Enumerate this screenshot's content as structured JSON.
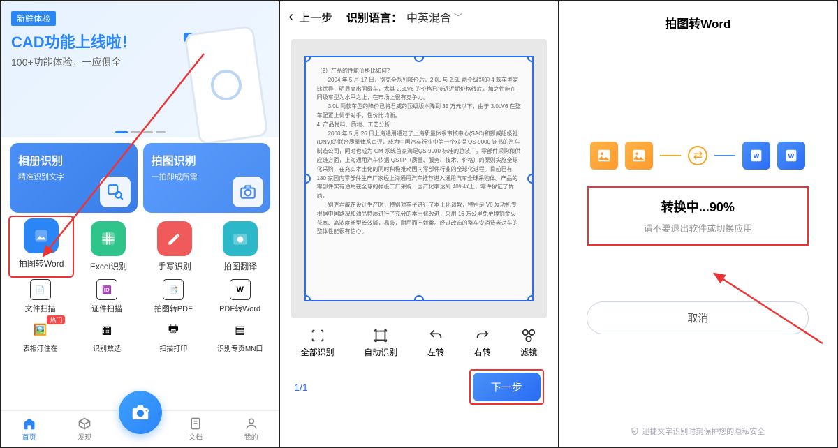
{
  "panel1": {
    "banner_badge": "新鲜体验",
    "banner_title": "CAD功能上线啦！",
    "banner_sub": "100+功能体验，一应俱全",
    "cad_tag": "CAD",
    "card_a_title": "相册识别",
    "card_a_sub": "精准识别文字",
    "card_b_title": "拍图识别",
    "card_b_sub": "一拍即成所需",
    "tiles": [
      {
        "label": "拍图转Word",
        "color": "#2b86f5"
      },
      {
        "label": "Excel识别",
        "color": "#2ec48a"
      },
      {
        "label": "手写识别",
        "color": "#f05a5a"
      },
      {
        "label": "拍图翻译",
        "color": "#2bb8c9"
      }
    ],
    "row4": [
      {
        "label": "文件扫描",
        "ic": "📄"
      },
      {
        "label": "证件扫描",
        "ic": "🆔"
      },
      {
        "label": "拍图转PDF",
        "ic": "📑"
      },
      {
        "label": "PDF转Word",
        "ic": "W"
      }
    ],
    "row4b": [
      {
        "label": "表相汀住在",
        "hot": "热门"
      },
      {
        "label": "识别数选",
        "hot": ""
      },
      {
        "label": "扫描打印",
        "hot": ""
      },
      {
        "label": "识别专页MN口",
        "hot": ""
      }
    ],
    "tabs": [
      "首页",
      "发现",
      "",
      "文档",
      "我的"
    ]
  },
  "panel2": {
    "back_label": "上一步",
    "lang_label": "识别语言：",
    "lang_value": "中英混合",
    "doc_text": "（2）产品的性能价格比如何？\n　　2004 年 5 月 17 日，别克全系列降价后，2.0L 与 2.5L 两个级别的 4 款车型家比优异，明显高出同级车，尤其 2.5LV6 的价格已接近近期价格线底，加之性能在同级车型为水平之上，在市场上很有竞争力。\n　　3.0L 两款车型的降价已将君威的顶级版本降到 35 万元以下，由于 3.0LV6 在整车配置上优于对手，性价比均衡。\n4. 产品材料、质地、工艺分析\n　　2000 年 5 月 26 日上海通用通过了上海质量体系审核中心(SAC)和挪威船级社(DNV)的联合质量体系审评，成为中国汽车行业中第一个获得 QS-9000 证书的汽车制造公司，同时也成为 GM 系统首家满足QS-9000 标准的总装厂。零部件采购和供应链方面，上海通用汽车依据 QSTP（质量、服务、技术、价格）的原则实施全球化采购，在充实本土化的同时积极推动国内零部件行业的全球化进程。目前已有 180 家国内零部件生产厂家经上海通用汽车推荐进入通用汽车全球采购体。产品的零部件实有通用在全球的样板工厂采购，国产化率达到 40%以上，零件保证了优质。\n　　别克君威在设计生产时，特别对车子进行了本土化调教，特别是 V6 发动机专根据中国路况和油品特质进行了充分的本土化改进，采用 16 万公里免更换铂金火花塞、高浓度新型长效碱，易装，耐用而不娇柔。经过改造的整车令消费者对车的整体性能很有信心。",
    "tools": [
      {
        "label": "全部识别"
      },
      {
        "label": "自动识别"
      },
      {
        "label": "左转"
      },
      {
        "label": "右转"
      },
      {
        "label": "滤镜"
      }
    ],
    "pager": "1/1",
    "next": "下一步"
  },
  "panel3": {
    "title": "拍图转Word",
    "progress_title": "转换中...90%",
    "progress_sub": "请不要退出软件或切换应用",
    "cancel": "取消",
    "privacy": "迅捷文字识别时刻保护您的隐私安全"
  }
}
